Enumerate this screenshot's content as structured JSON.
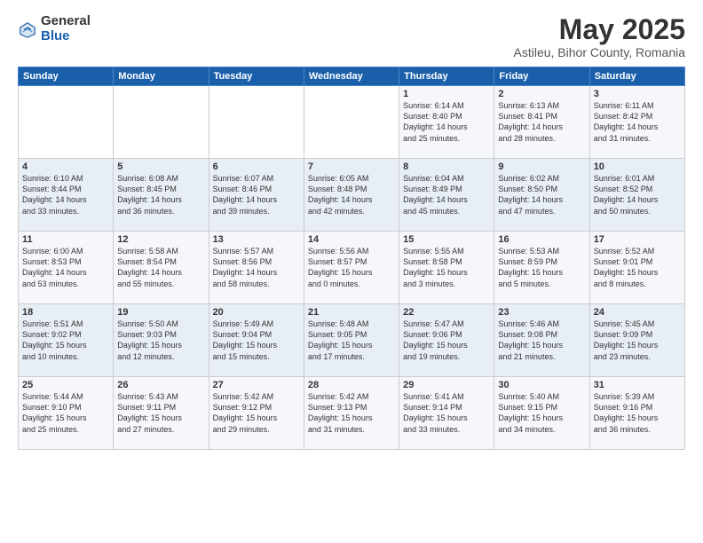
{
  "logo": {
    "general": "General",
    "blue": "Blue"
  },
  "title": "May 2025",
  "subtitle": "Astileu, Bihor County, Romania",
  "days_header": [
    "Sunday",
    "Monday",
    "Tuesday",
    "Wednesday",
    "Thursday",
    "Friday",
    "Saturday"
  ],
  "weeks": [
    [
      {
        "day": "",
        "info": ""
      },
      {
        "day": "",
        "info": ""
      },
      {
        "day": "",
        "info": ""
      },
      {
        "day": "",
        "info": ""
      },
      {
        "day": "1",
        "info": "Sunrise: 6:14 AM\nSunset: 8:40 PM\nDaylight: 14 hours\nand 25 minutes."
      },
      {
        "day": "2",
        "info": "Sunrise: 6:13 AM\nSunset: 8:41 PM\nDaylight: 14 hours\nand 28 minutes."
      },
      {
        "day": "3",
        "info": "Sunrise: 6:11 AM\nSunset: 8:42 PM\nDaylight: 14 hours\nand 31 minutes."
      }
    ],
    [
      {
        "day": "4",
        "info": "Sunrise: 6:10 AM\nSunset: 8:44 PM\nDaylight: 14 hours\nand 33 minutes."
      },
      {
        "day": "5",
        "info": "Sunrise: 6:08 AM\nSunset: 8:45 PM\nDaylight: 14 hours\nand 36 minutes."
      },
      {
        "day": "6",
        "info": "Sunrise: 6:07 AM\nSunset: 8:46 PM\nDaylight: 14 hours\nand 39 minutes."
      },
      {
        "day": "7",
        "info": "Sunrise: 6:05 AM\nSunset: 8:48 PM\nDaylight: 14 hours\nand 42 minutes."
      },
      {
        "day": "8",
        "info": "Sunrise: 6:04 AM\nSunset: 8:49 PM\nDaylight: 14 hours\nand 45 minutes."
      },
      {
        "day": "9",
        "info": "Sunrise: 6:02 AM\nSunset: 8:50 PM\nDaylight: 14 hours\nand 47 minutes."
      },
      {
        "day": "10",
        "info": "Sunrise: 6:01 AM\nSunset: 8:52 PM\nDaylight: 14 hours\nand 50 minutes."
      }
    ],
    [
      {
        "day": "11",
        "info": "Sunrise: 6:00 AM\nSunset: 8:53 PM\nDaylight: 14 hours\nand 53 minutes."
      },
      {
        "day": "12",
        "info": "Sunrise: 5:58 AM\nSunset: 8:54 PM\nDaylight: 14 hours\nand 55 minutes."
      },
      {
        "day": "13",
        "info": "Sunrise: 5:57 AM\nSunset: 8:56 PM\nDaylight: 14 hours\nand 58 minutes."
      },
      {
        "day": "14",
        "info": "Sunrise: 5:56 AM\nSunset: 8:57 PM\nDaylight: 15 hours\nand 0 minutes."
      },
      {
        "day": "15",
        "info": "Sunrise: 5:55 AM\nSunset: 8:58 PM\nDaylight: 15 hours\nand 3 minutes."
      },
      {
        "day": "16",
        "info": "Sunrise: 5:53 AM\nSunset: 8:59 PM\nDaylight: 15 hours\nand 5 minutes."
      },
      {
        "day": "17",
        "info": "Sunrise: 5:52 AM\nSunset: 9:01 PM\nDaylight: 15 hours\nand 8 minutes."
      }
    ],
    [
      {
        "day": "18",
        "info": "Sunrise: 5:51 AM\nSunset: 9:02 PM\nDaylight: 15 hours\nand 10 minutes."
      },
      {
        "day": "19",
        "info": "Sunrise: 5:50 AM\nSunset: 9:03 PM\nDaylight: 15 hours\nand 12 minutes."
      },
      {
        "day": "20",
        "info": "Sunrise: 5:49 AM\nSunset: 9:04 PM\nDaylight: 15 hours\nand 15 minutes."
      },
      {
        "day": "21",
        "info": "Sunrise: 5:48 AM\nSunset: 9:05 PM\nDaylight: 15 hours\nand 17 minutes."
      },
      {
        "day": "22",
        "info": "Sunrise: 5:47 AM\nSunset: 9:06 PM\nDaylight: 15 hours\nand 19 minutes."
      },
      {
        "day": "23",
        "info": "Sunrise: 5:46 AM\nSunset: 9:08 PM\nDaylight: 15 hours\nand 21 minutes."
      },
      {
        "day": "24",
        "info": "Sunrise: 5:45 AM\nSunset: 9:09 PM\nDaylight: 15 hours\nand 23 minutes."
      }
    ],
    [
      {
        "day": "25",
        "info": "Sunrise: 5:44 AM\nSunset: 9:10 PM\nDaylight: 15 hours\nand 25 minutes."
      },
      {
        "day": "26",
        "info": "Sunrise: 5:43 AM\nSunset: 9:11 PM\nDaylight: 15 hours\nand 27 minutes."
      },
      {
        "day": "27",
        "info": "Sunrise: 5:42 AM\nSunset: 9:12 PM\nDaylight: 15 hours\nand 29 minutes."
      },
      {
        "day": "28",
        "info": "Sunrise: 5:42 AM\nSunset: 9:13 PM\nDaylight: 15 hours\nand 31 minutes."
      },
      {
        "day": "29",
        "info": "Sunrise: 5:41 AM\nSunset: 9:14 PM\nDaylight: 15 hours\nand 33 minutes."
      },
      {
        "day": "30",
        "info": "Sunrise: 5:40 AM\nSunset: 9:15 PM\nDaylight: 15 hours\nand 34 minutes."
      },
      {
        "day": "31",
        "info": "Sunrise: 5:39 AM\nSunset: 9:16 PM\nDaylight: 15 hours\nand 36 minutes."
      }
    ]
  ]
}
